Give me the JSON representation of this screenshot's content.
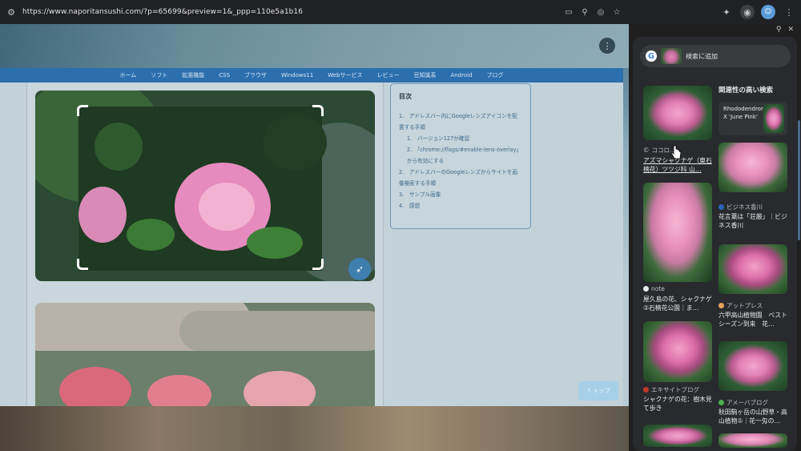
{
  "browser": {
    "url": "https://www.naporitansushi.com/?p=65699&preview=1&_ppp=110e5a1b16"
  },
  "site": {
    "nav": [
      "ホーム",
      "ソフト",
      "拡張機能",
      "CSS",
      "ブラウザ",
      "Windows11",
      "Webサービス",
      "レビュー",
      "豆知識系",
      "Android",
      "ブログ"
    ],
    "toc": {
      "title": "目次",
      "items": [
        "1.　アドレスバー内にGoogleレンズアイコンを配置する手順",
        "1.　バージョン127か確認",
        "2.　「chrome://flags/#enable-lens-overlay」から有効にする",
        "2.　アドレスバーのGoogleレンズからサイトを画像検索する手順",
        "3.　サンプル画像",
        "4.　感想"
      ]
    },
    "top_button": "↑ トップ"
  },
  "lens_panel": {
    "add_to_search": "検索に追加",
    "related_title": "関連性の高い検索",
    "related_chip": "Rhododendron X 'June Pink'",
    "results": [
      {
        "source": "ココロ…",
        "caption": "アズマシャクナゲ（東石楠花）ツツジ科 山…"
      },
      {
        "source": "note",
        "caption": "屋久島の花、シャクナゲ②石楠花公園｜ま…"
      },
      {
        "source": "エキサイトブログ",
        "caption": "シャクナゲの花：樹木見て歩き"
      },
      {
        "source": "ビジネス香川",
        "caption": "花言葉は「荘厳」｜ビジネス香川"
      },
      {
        "source": "アットプレス",
        "caption": "六甲高山植物園　ベストシーズン到来　花…"
      },
      {
        "source": "アメーバブログ",
        "caption": "秋田駒ヶ岳の山野草・高山植物①｜花一匁の…"
      }
    ]
  },
  "colors": {
    "nav_bar": "#2b6fae",
    "panel_bg": "#282a2d",
    "chrome_bg": "#202124"
  }
}
